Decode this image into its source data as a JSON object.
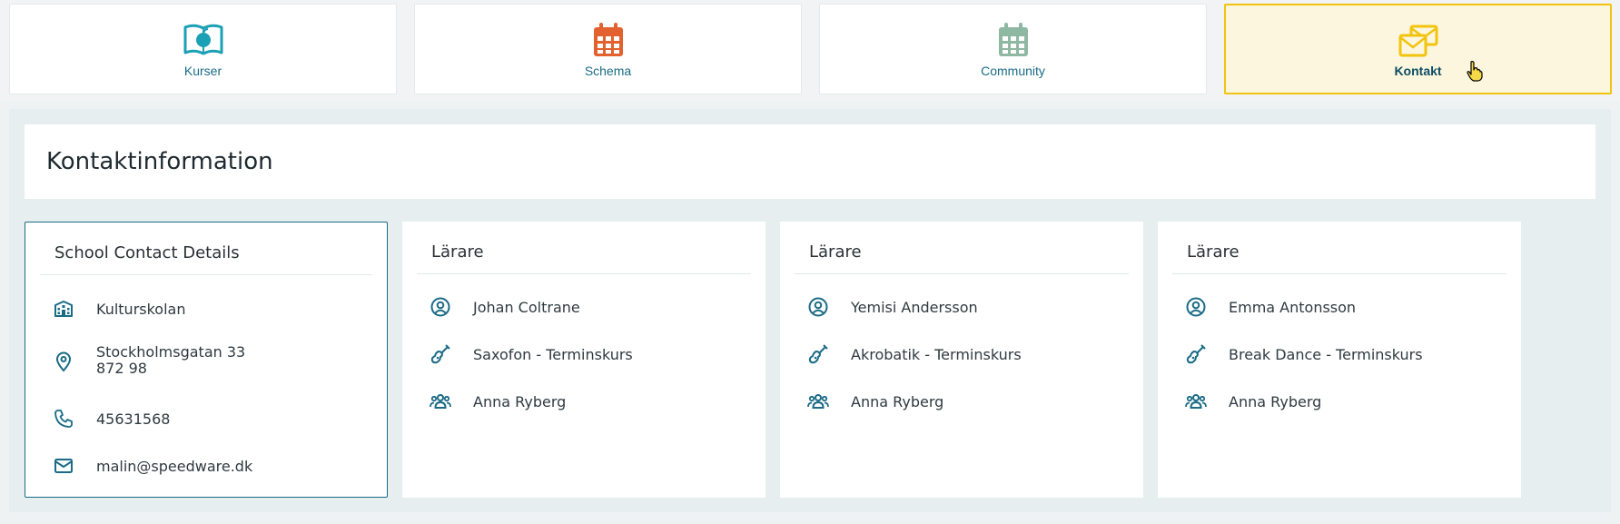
{
  "nav": {
    "tiles": [
      {
        "label": "Kurser",
        "icon": "book-apple-icon",
        "color": "#1ba0b5"
      },
      {
        "label": "Schema",
        "icon": "calendar-icon",
        "color": "#e2612f"
      },
      {
        "label": "Community",
        "icon": "calendar-icon",
        "color": "#8fb8a3"
      },
      {
        "label": "Kontakt",
        "icon": "envelopes-icon",
        "color": "#f1c40f",
        "active": true
      }
    ]
  },
  "main": {
    "title": "Kontaktinformation",
    "school": {
      "title": "School Contact Details",
      "name": "Kulturskolan",
      "address_line1": "Stockholmsgatan 33",
      "address_line2": "872 98",
      "phone": "45631568",
      "email": "malin@speedware.dk"
    },
    "teachers": [
      {
        "heading": "Lärare",
        "name": "Johan Coltrane",
        "course": "Saxofon - Terminskurs",
        "contact": "Anna Ryberg"
      },
      {
        "heading": "Lärare",
        "name": "Yemisi Andersson",
        "course": "Akrobatik - Terminskurs",
        "contact": "Anna Ryberg"
      },
      {
        "heading": "Lärare",
        "name": "Emma Antonsson",
        "course": "Break Dance - Terminskurs",
        "contact": "Anna Ryberg"
      }
    ]
  },
  "colors": {
    "accent": "#1a6b86",
    "active_bg": "#fdf6de",
    "active_border": "#f1c40f"
  }
}
